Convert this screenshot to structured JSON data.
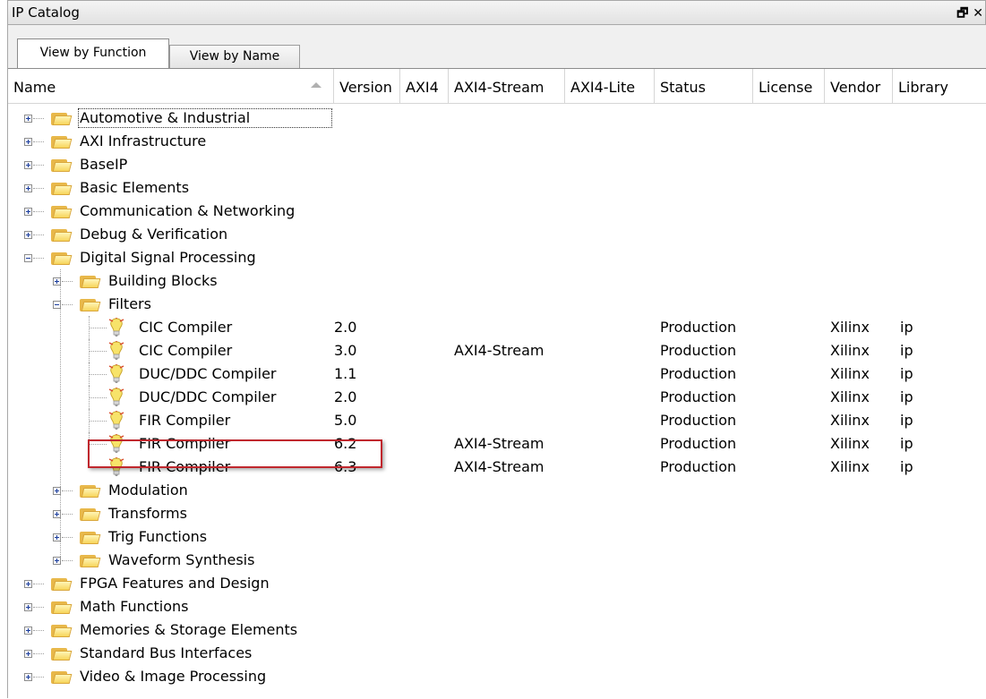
{
  "window": {
    "title": "IP Catalog",
    "icons": [
      "restore-icon",
      "close-icon"
    ],
    "close_glyph": "✕",
    "restore_glyph": "🗗"
  },
  "tabs": [
    {
      "label": "View by Function",
      "active": true
    },
    {
      "label": "View by Name",
      "active": false
    }
  ],
  "columns": [
    "Name",
    "Version",
    "AXI4",
    "AXI4-Stream",
    "AXI4-Lite",
    "Status",
    "License",
    "Vendor",
    "Library"
  ],
  "tree": [
    {
      "depth": 0,
      "type": "folder",
      "expanded": false,
      "name": "Automotive & Industrial",
      "focused": true
    },
    {
      "depth": 0,
      "type": "folder",
      "expanded": false,
      "name": "AXI Infrastructure"
    },
    {
      "depth": 0,
      "type": "folder",
      "expanded": false,
      "name": "BaseIP"
    },
    {
      "depth": 0,
      "type": "folder",
      "expanded": false,
      "name": "Basic Elements"
    },
    {
      "depth": 0,
      "type": "folder",
      "expanded": false,
      "name": "Communication & Networking"
    },
    {
      "depth": 0,
      "type": "folder",
      "expanded": false,
      "name": "Debug & Verification"
    },
    {
      "depth": 0,
      "type": "folder",
      "expanded": true,
      "name": "Digital Signal Processing"
    },
    {
      "depth": 1,
      "type": "folder",
      "expanded": false,
      "name": "Building Blocks"
    },
    {
      "depth": 1,
      "type": "folder",
      "expanded": true,
      "name": "Filters"
    },
    {
      "depth": 2,
      "type": "ip",
      "name": "CIC Compiler",
      "version": "2.0",
      "axi4": "",
      "axi4_stream": "",
      "axi4_lite": "",
      "status": "Production",
      "license": "",
      "vendor": "Xilinx",
      "library": "ip"
    },
    {
      "depth": 2,
      "type": "ip",
      "name": "CIC Compiler",
      "version": "3.0",
      "axi4": "",
      "axi4_stream": "AXI4-Stream",
      "axi4_lite": "",
      "status": "Production",
      "license": "",
      "vendor": "Xilinx",
      "library": "ip"
    },
    {
      "depth": 2,
      "type": "ip",
      "name": "DUC/DDC Compiler",
      "version": "1.1",
      "axi4": "",
      "axi4_stream": "",
      "axi4_lite": "",
      "status": "Production",
      "license": "",
      "vendor": "Xilinx",
      "library": "ip"
    },
    {
      "depth": 2,
      "type": "ip",
      "name": "DUC/DDC Compiler",
      "version": "2.0",
      "axi4": "",
      "axi4_stream": "",
      "axi4_lite": "",
      "status": "Production",
      "license": "",
      "vendor": "Xilinx",
      "library": "ip"
    },
    {
      "depth": 2,
      "type": "ip",
      "name": "FIR Compiler",
      "version": "5.0",
      "axi4": "",
      "axi4_stream": "",
      "axi4_lite": "",
      "status": "Production",
      "license": "",
      "vendor": "Xilinx",
      "library": "ip"
    },
    {
      "depth": 2,
      "type": "ip",
      "name": "FIR Compiler",
      "version": "6.2",
      "axi4": "",
      "axi4_stream": "AXI4-Stream",
      "axi4_lite": "",
      "status": "Production",
      "license": "",
      "vendor": "Xilinx",
      "library": "ip"
    },
    {
      "depth": 2,
      "type": "ip",
      "name": "FIR Compiler",
      "version": "6.3",
      "axi4": "",
      "axi4_stream": "AXI4-Stream",
      "axi4_lite": "",
      "status": "Production",
      "license": "",
      "vendor": "Xilinx",
      "library": "ip",
      "highlighted": true
    },
    {
      "depth": 1,
      "type": "folder",
      "expanded": false,
      "name": "Modulation"
    },
    {
      "depth": 1,
      "type": "folder",
      "expanded": false,
      "name": "Transforms"
    },
    {
      "depth": 1,
      "type": "folder",
      "expanded": false,
      "name": "Trig Functions"
    },
    {
      "depth": 1,
      "type": "folder",
      "expanded": false,
      "name": "Waveform Synthesis"
    },
    {
      "depth": 0,
      "type": "folder",
      "expanded": false,
      "name": "FPGA Features and Design"
    },
    {
      "depth": 0,
      "type": "folder",
      "expanded": false,
      "name": "Math Functions"
    },
    {
      "depth": 0,
      "type": "folder",
      "expanded": false,
      "name": "Memories & Storage Elements"
    },
    {
      "depth": 0,
      "type": "folder",
      "expanded": false,
      "name": "Standard Bus Interfaces"
    },
    {
      "depth": 0,
      "type": "folder",
      "expanded": false,
      "name": "Video & Image Processing"
    }
  ],
  "colors": {
    "highlight_border": "#c0272d",
    "folder": "#f7d45a",
    "expander": "#1a3c9c"
  }
}
